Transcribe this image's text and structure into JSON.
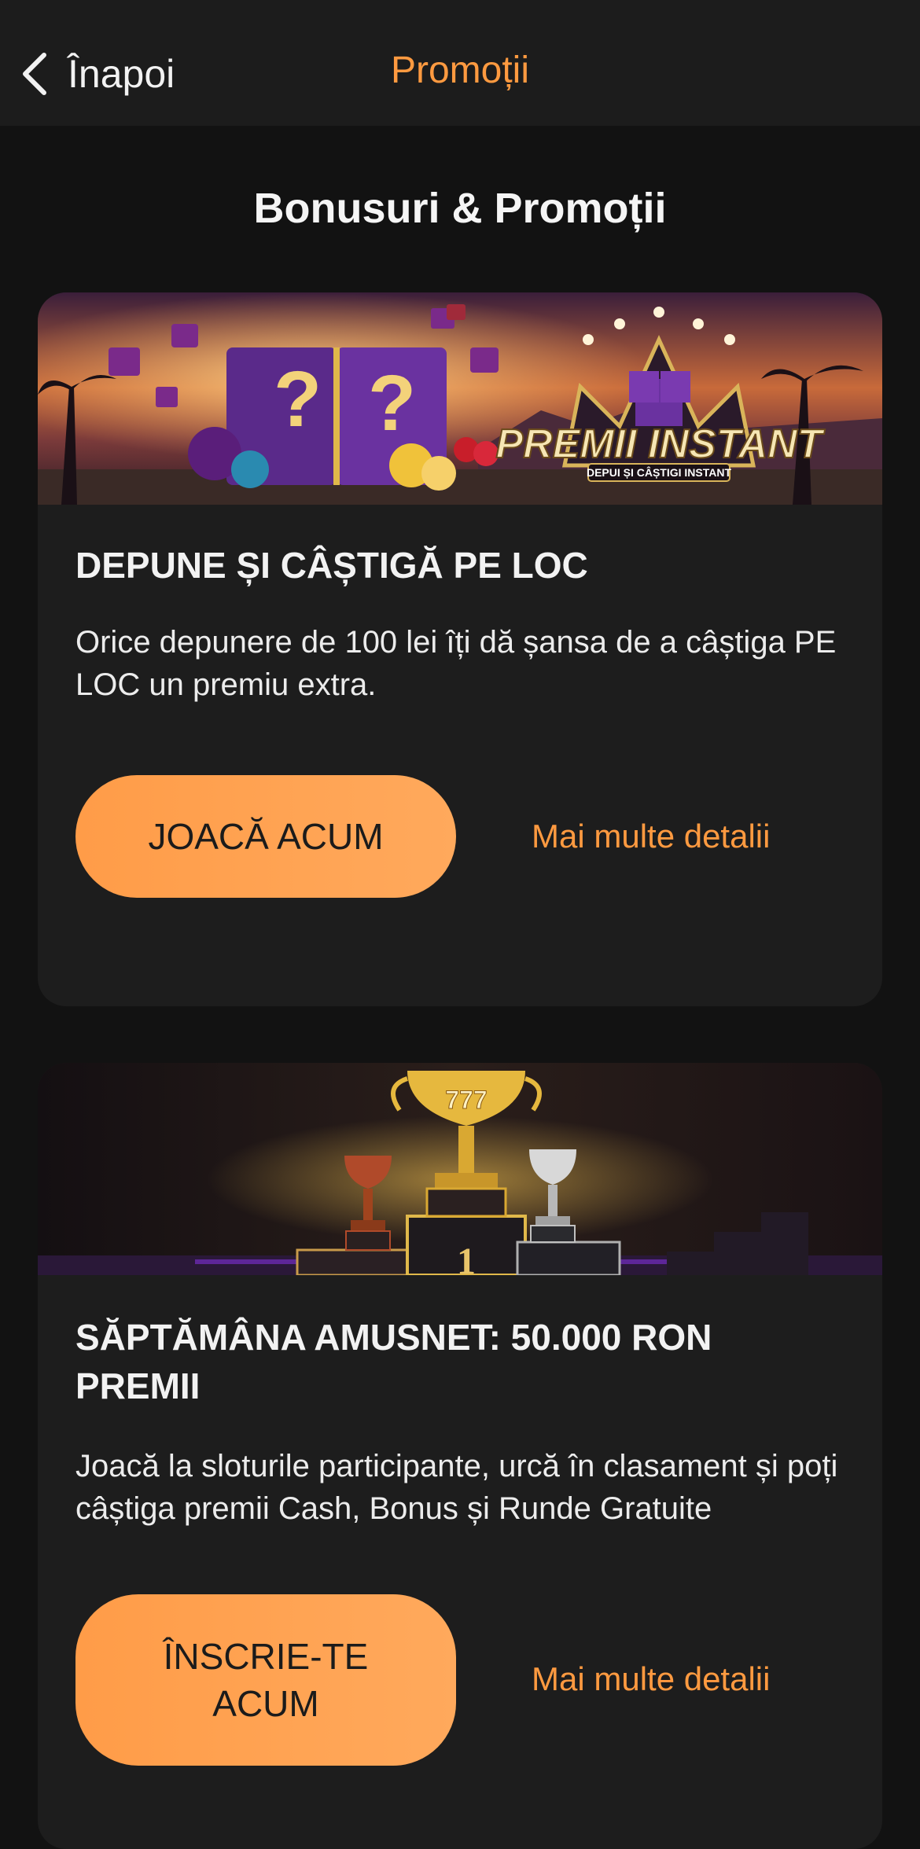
{
  "header": {
    "back_label": "Înapoi",
    "title": "Promoții"
  },
  "page": {
    "section_title": "Bonusuri & Promoții"
  },
  "promos": [
    {
      "banner_logo_text": "PREMII INSTANT",
      "banner_logo_subtext": "DEPUI ȘI CÂȘTIGI INSTANT",
      "title": "DEPUNE ȘI CÂȘTIGĂ PE LOC",
      "description": "Orice depunere de 100 lei îți dă șansa de a câștiga PE LOC un premiu extra.",
      "cta_label": "JOACĂ ACUM",
      "details_label": "Mai multe detalii"
    },
    {
      "banner_trophy_text": "777",
      "banner_podium_text": "1",
      "title": "SĂPTĂMÂNA AMUSNET: 50.000 RON PREMII",
      "description": "Joacă la sloturile participante, urcă în clasament și poți câștiga premii Cash, Bonus și Runde Gratuite",
      "cta_label": "ÎNSCRIE-TE ACUM",
      "details_label": "Mai multe detalii"
    }
  ],
  "colors": {
    "accent": "#ff9a40",
    "background": "#121212",
    "card": "#1d1d1d",
    "header": "#1c1c1c"
  }
}
